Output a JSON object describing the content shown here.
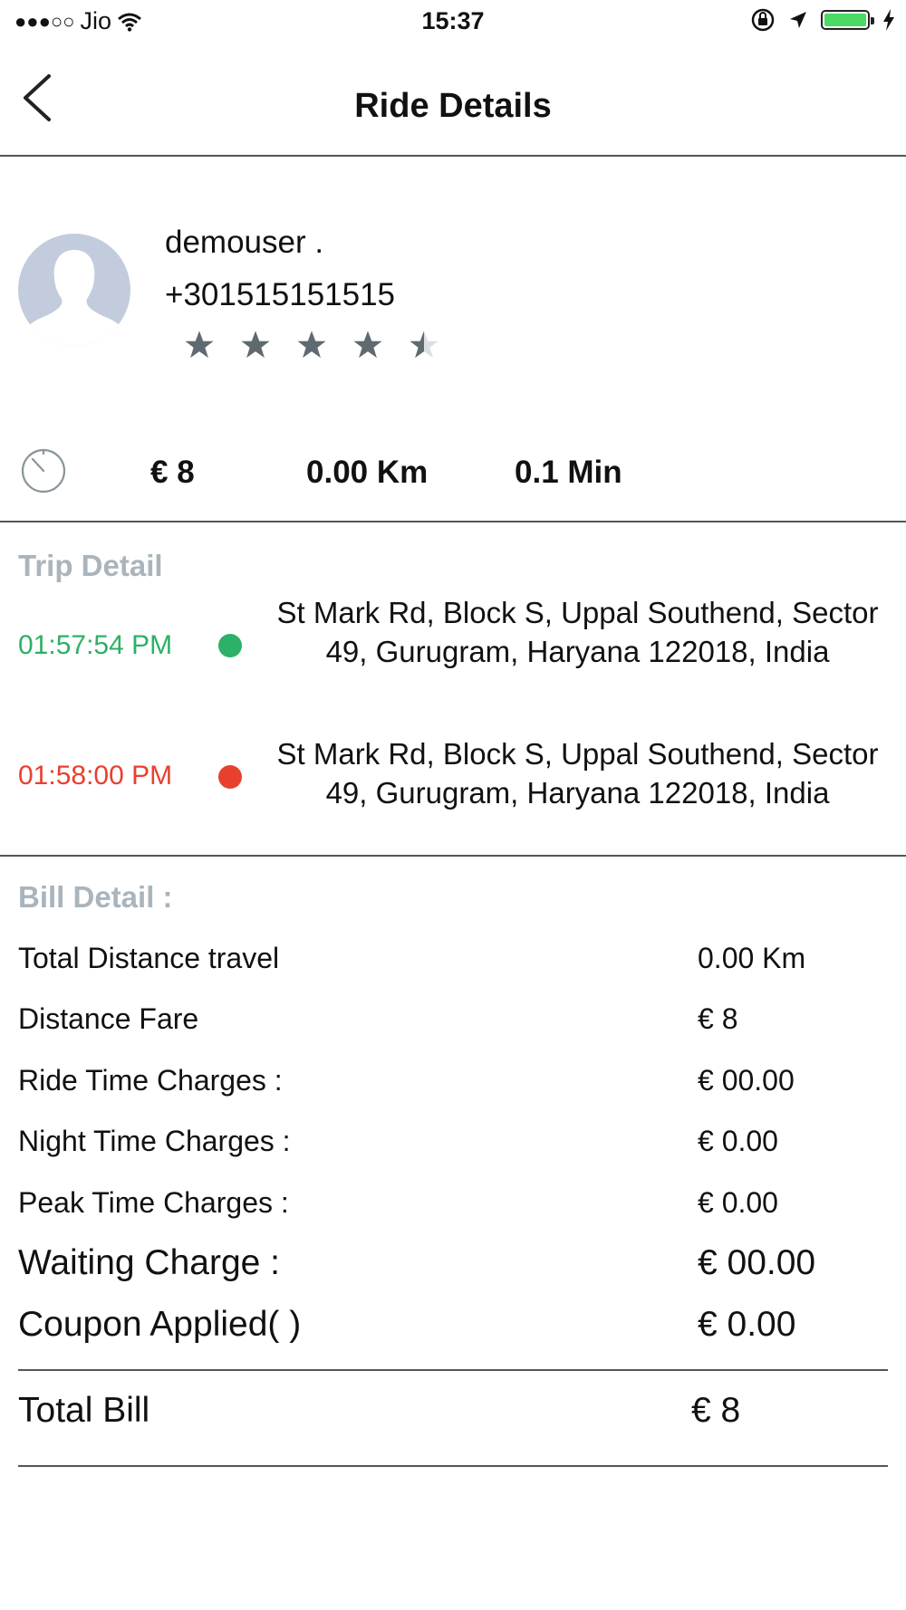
{
  "status_bar": {
    "signal_dots": "●●●○○",
    "carrier": "Jio",
    "time": "15:37",
    "battery_level": 1.0,
    "battery_color": "#4cd964"
  },
  "header": {
    "title": "Ride Details",
    "back_icon": "chevron-left-icon"
  },
  "profile": {
    "name": "demouser .",
    "phone": "+301515151515",
    "rating": 4.5,
    "avatar_color": "#c3ccdd"
  },
  "stats": {
    "fare": "€ 8",
    "distance": "0.00 Km",
    "duration": "0.1 Min"
  },
  "trip_detail": {
    "heading": "Trip Detail",
    "stops": [
      {
        "time": "01:57:54 PM",
        "color": "#2db067",
        "address": "St Mark Rd, Block S, Uppal Southend, Sector 49, Gurugram, Haryana 122018, India"
      },
      {
        "time": "01:58:00 PM",
        "color": "#e8402f",
        "address": "St Mark Rd, Block S, Uppal Southend, Sector 49, Gurugram, Haryana 122018, India"
      }
    ]
  },
  "bill_detail": {
    "heading": "Bill Detail :",
    "rows": [
      {
        "label": "Total Distance travel",
        "value": "0.00 Km"
      },
      {
        "label": "Distance Fare",
        "value": "€ 8"
      },
      {
        "label": "Ride Time Charges :",
        "value": "€ 00.00"
      },
      {
        "label": "Night Time Charges :",
        "value": "€ 0.00"
      },
      {
        "label": "Peak Time Charges :",
        "value": "€ 0.00"
      },
      {
        "label": "Waiting Charge :",
        "value": "€ 00.00"
      },
      {
        "label": "Coupon Applied(  )",
        "value": "€ 0.00"
      }
    ],
    "total_label": "Total Bill",
    "total_value": "€ 8"
  }
}
